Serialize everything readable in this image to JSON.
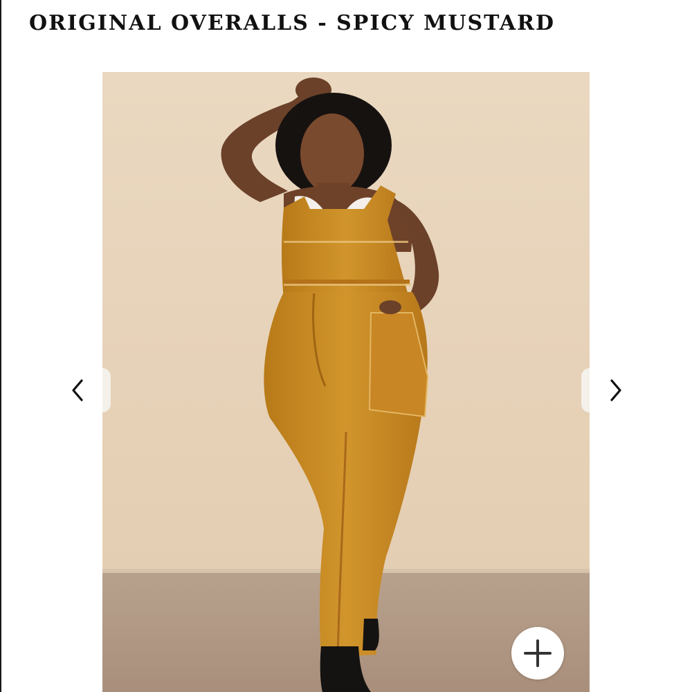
{
  "product": {
    "title": "ORIGINAL OVERALLS - SPICY MUSTARD"
  },
  "gallery": {
    "image_alt": "Model wearing Original Overalls in Spicy Mustard with a white tank top and black boots",
    "prev_icon": "chevron-left-icon",
    "next_icon": "chevron-right-icon",
    "zoom_icon": "plus-icon"
  },
  "colors": {
    "overalls": "#c98a22",
    "backdrop": "#e9d6bd",
    "floor": "#b39a86",
    "title_text": "#111111"
  }
}
